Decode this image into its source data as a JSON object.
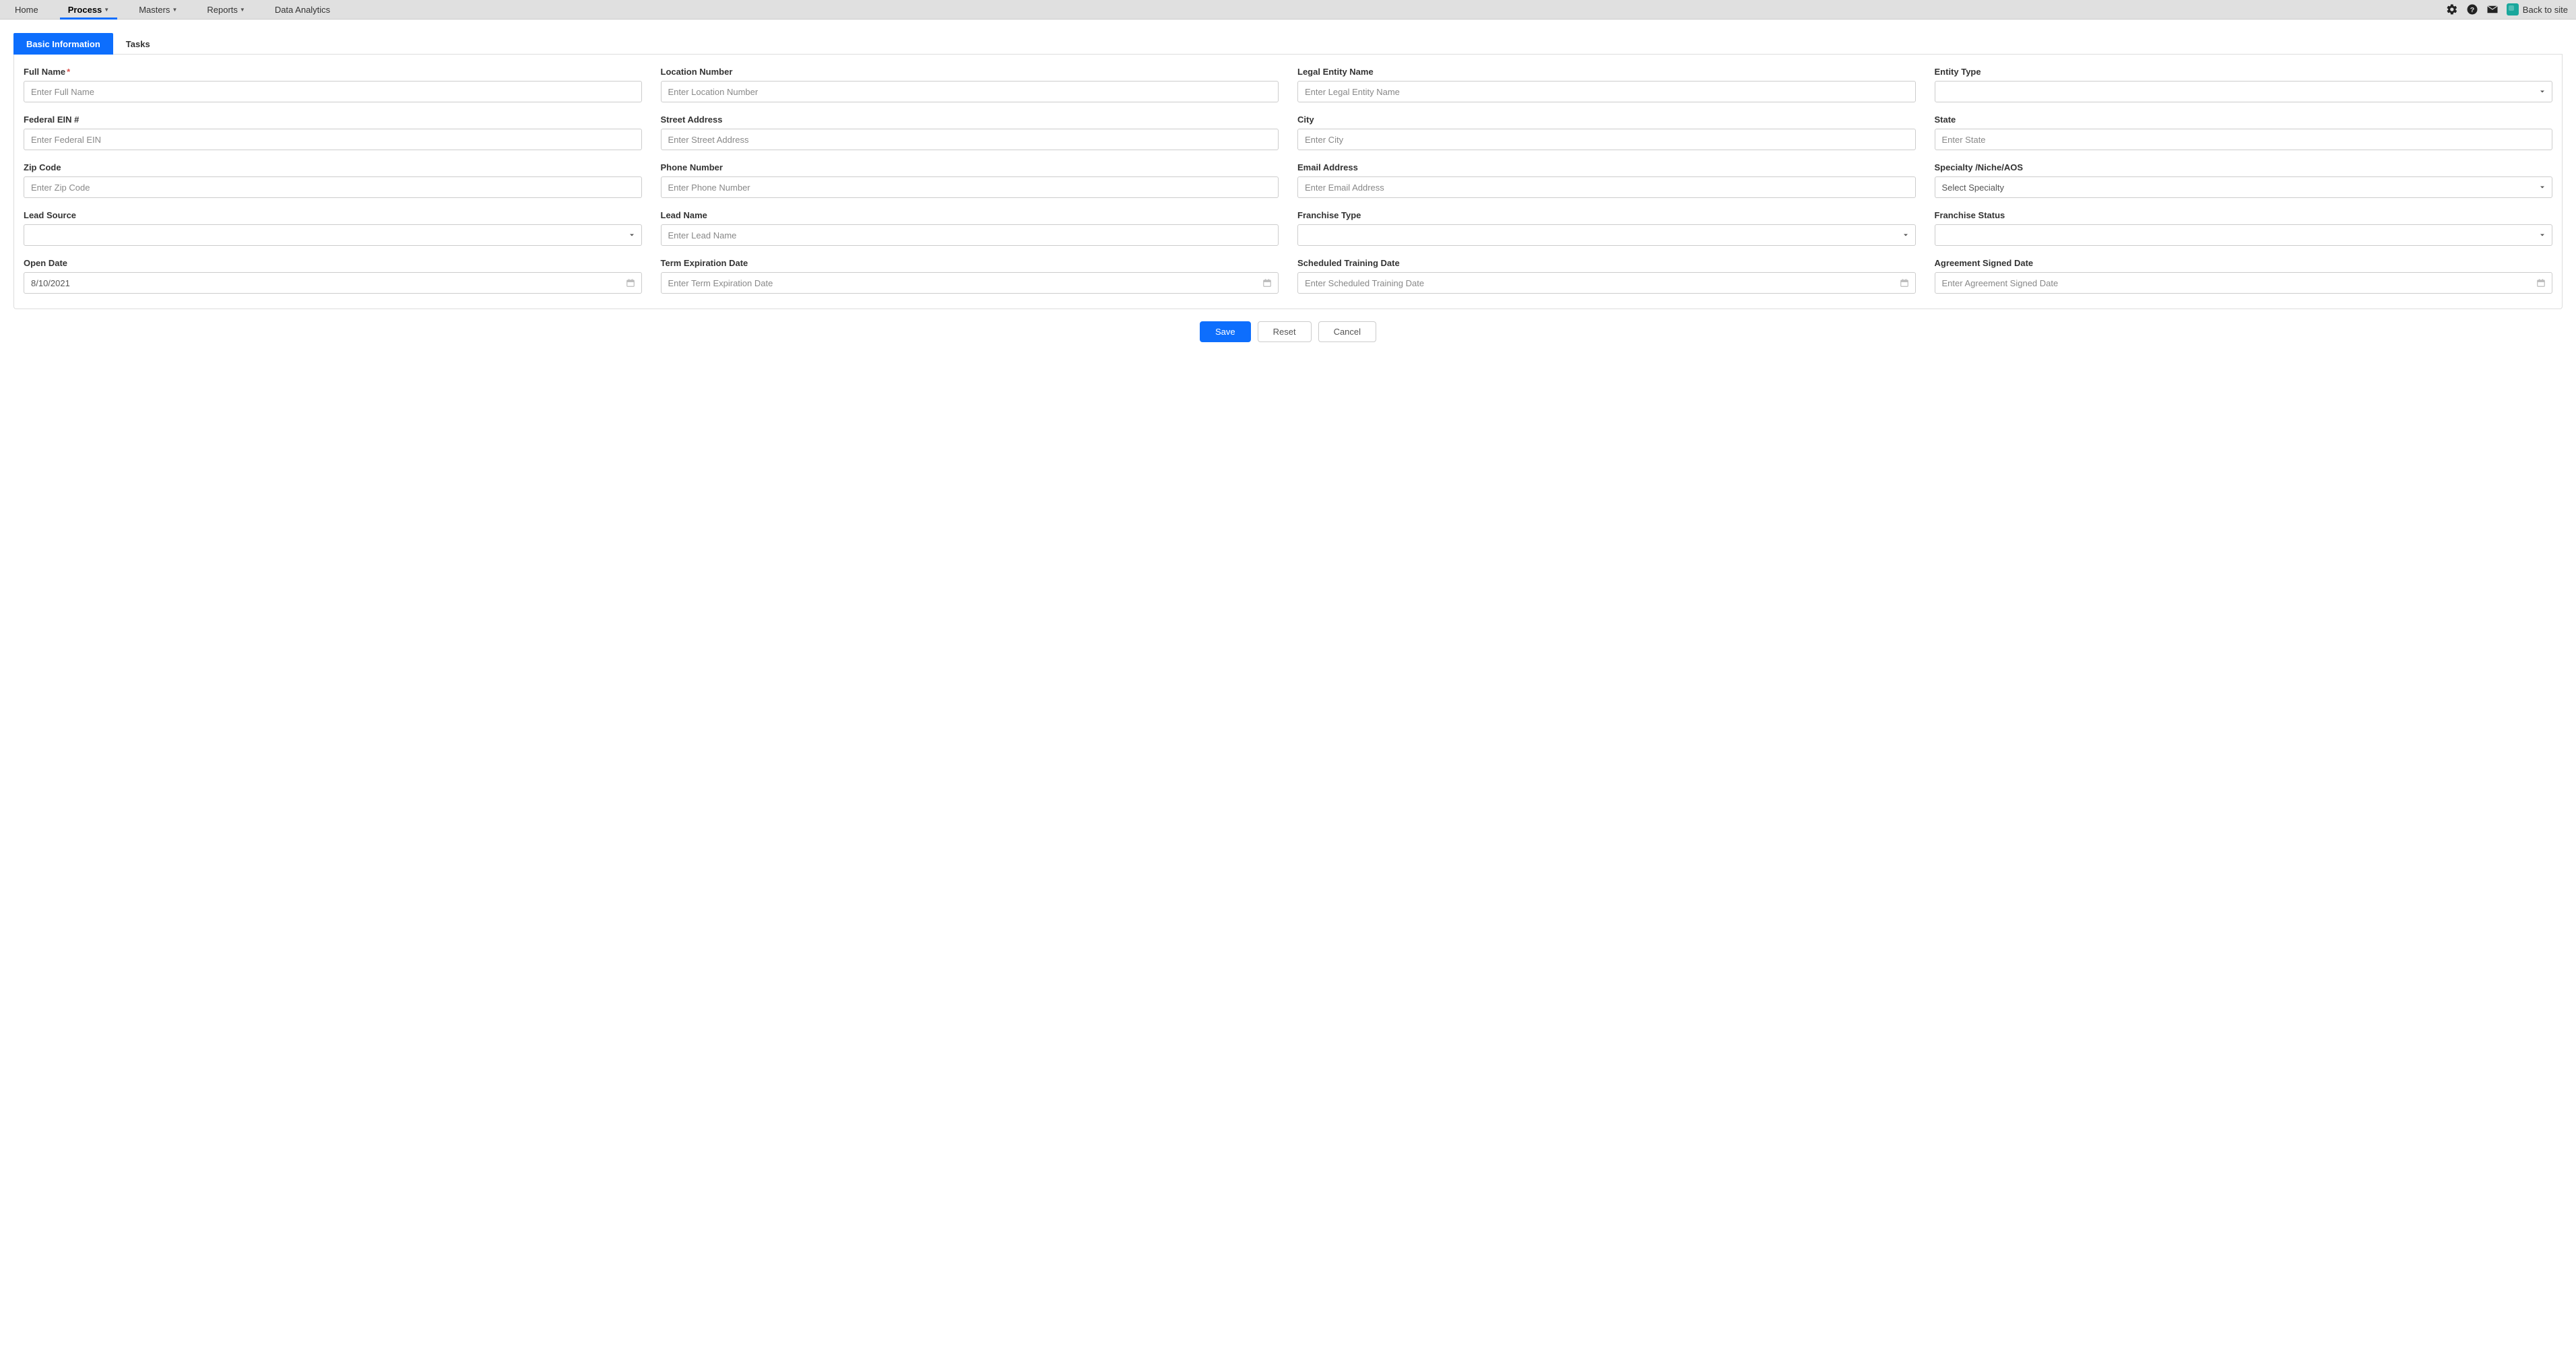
{
  "nav": {
    "items": [
      {
        "label": "Home",
        "dropdown": false
      },
      {
        "label": "Process",
        "dropdown": true
      },
      {
        "label": "Masters",
        "dropdown": true
      },
      {
        "label": "Reports",
        "dropdown": true
      },
      {
        "label": "Data Analytics",
        "dropdown": false
      }
    ],
    "back_label": "Back to site"
  },
  "tabs": {
    "basic_info": "Basic Information",
    "tasks": "Tasks"
  },
  "form": {
    "full_name": {
      "label": "Full Name",
      "placeholder": "Enter Full Name",
      "required": true
    },
    "location_number": {
      "label": "Location Number",
      "placeholder": "Enter Location Number"
    },
    "legal_entity": {
      "label": "Legal Entity Name",
      "placeholder": "Enter Legal Entity Name"
    },
    "entity_type": {
      "label": "Entity Type",
      "placeholder": ""
    },
    "federal_ein": {
      "label": "Federal EIN #",
      "placeholder": "Enter Federal EIN"
    },
    "street_address": {
      "label": "Street Address",
      "placeholder": "Enter Street Address"
    },
    "city": {
      "label": "City",
      "placeholder": "Enter City"
    },
    "state": {
      "label": "State",
      "placeholder": "Enter State"
    },
    "zip_code": {
      "label": "Zip Code",
      "placeholder": "Enter Zip Code"
    },
    "phone_number": {
      "label": "Phone Number",
      "placeholder": "Enter Phone Number"
    },
    "email_address": {
      "label": "Email Address",
      "placeholder": "Enter Email Address"
    },
    "specialty": {
      "label": "Specialty /Niche/AOS",
      "placeholder": "Select Specialty"
    },
    "lead_source": {
      "label": "Lead Source",
      "placeholder": ""
    },
    "lead_name": {
      "label": "Lead Name",
      "placeholder": "Enter Lead Name"
    },
    "franchise_type": {
      "label": "Franchise Type",
      "placeholder": ""
    },
    "franchise_status": {
      "label": "Franchise Status",
      "placeholder": ""
    },
    "open_date": {
      "label": "Open Date",
      "value": "8/10/2021"
    },
    "term_expiration": {
      "label": "Term Expiration Date",
      "placeholder": "Enter Term Expiration Date"
    },
    "scheduled_training": {
      "label": "Scheduled Training Date",
      "placeholder": "Enter Scheduled Training Date"
    },
    "agreement_signed": {
      "label": "Agreement Signed Date",
      "placeholder": "Enter Agreement Signed Date"
    }
  },
  "buttons": {
    "save": "Save",
    "reset": "Reset",
    "cancel": "Cancel"
  }
}
